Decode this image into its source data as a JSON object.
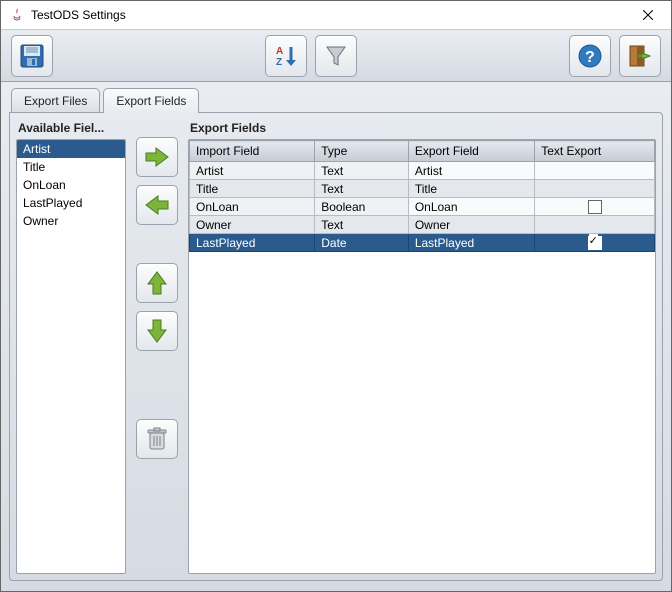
{
  "window": {
    "title": "TestODS Settings"
  },
  "tabs": [
    {
      "label": "Export Files",
      "active": false
    },
    {
      "label": "Export Fields",
      "active": true
    }
  ],
  "available": {
    "title": "Available Fiel...",
    "items": [
      "Artist",
      "Title",
      "OnLoan",
      "LastPlayed",
      "Owner"
    ],
    "selected_index": 0
  },
  "export": {
    "title": "Export Fields",
    "columns": [
      "Import Field",
      "Type",
      "Export Field",
      "Text Export"
    ],
    "rows": [
      {
        "import": "Artist",
        "type": "Text",
        "export": "Artist",
        "text_export": null
      },
      {
        "import": "Title",
        "type": "Text",
        "export": "Title",
        "text_export": null
      },
      {
        "import": "OnLoan",
        "type": "Boolean",
        "export": "OnLoan",
        "text_export": false
      },
      {
        "import": "Owner",
        "type": "Text",
        "export": "Owner",
        "text_export": null
      },
      {
        "import": "LastPlayed",
        "type": "Date",
        "export": "LastPlayed",
        "text_export": true
      }
    ],
    "selected_index": 4
  },
  "icons": {
    "save": "save-icon",
    "sort": "sort-az-icon",
    "filter": "filter-icon",
    "help": "help-icon",
    "exit": "exit-icon",
    "java": "java-icon",
    "right": "arrow-right-icon",
    "left": "arrow-left-icon",
    "up": "arrow-up-icon",
    "down": "arrow-down-icon",
    "trash": "trash-icon"
  },
  "colors": {
    "selection": "#2b5b8c",
    "arrow_fill": "#7db53b",
    "help": "#2f7bbf"
  }
}
